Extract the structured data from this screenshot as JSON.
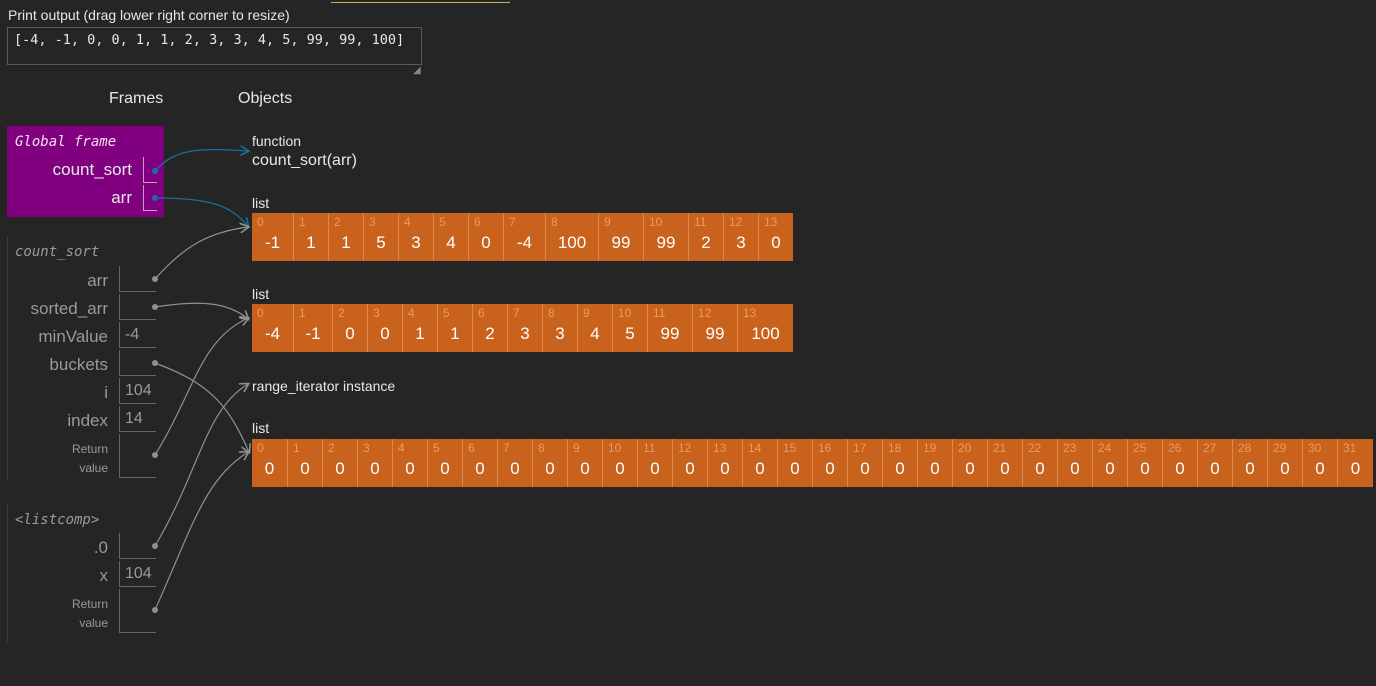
{
  "print_output": {
    "label": "Print output (drag lower right corner to resize)",
    "text": "[-4, -1, 0, 0, 1, 1, 2, 3, 3, 4, 5, 99, 99, 100]"
  },
  "headers": {
    "frames": "Frames",
    "objects": "Objects"
  },
  "global_frame": {
    "title": "Global frame",
    "vars": [
      {
        "name": "count_sort"
      },
      {
        "name": "arr"
      }
    ]
  },
  "count_sort_frame": {
    "title": "count_sort",
    "vars": [
      {
        "name": "arr",
        "value": ""
      },
      {
        "name": "sorted_arr",
        "value": ""
      },
      {
        "name": "minValue",
        "value": "-4"
      },
      {
        "name": "buckets",
        "value": ""
      },
      {
        "name": "i",
        "value": "104"
      },
      {
        "name": "index",
        "value": "14"
      }
    ],
    "return_label_1": "Return",
    "return_label_2": "value"
  },
  "listcomp_frame": {
    "title": "<listcomp>",
    "vars": [
      {
        "name": ".0",
        "value": ""
      },
      {
        "name": "x",
        "value": "104"
      }
    ],
    "return_label_1": "Return",
    "return_label_2": "value"
  },
  "objects": {
    "function": {
      "type_label": "function",
      "signature": "count_sort(arr)"
    },
    "list1": {
      "type_label": "list",
      "indices": [
        "0",
        "1",
        "2",
        "3",
        "4",
        "5",
        "6",
        "7",
        "8",
        "9",
        "10",
        "11",
        "12",
        "13"
      ],
      "values": [
        "-1",
        "1",
        "1",
        "5",
        "3",
        "4",
        "0",
        "-4",
        "100",
        "99",
        "99",
        "2",
        "3",
        "0"
      ]
    },
    "list2": {
      "type_label": "list",
      "indices": [
        "0",
        "1",
        "2",
        "3",
        "4",
        "5",
        "6",
        "7",
        "8",
        "9",
        "10",
        "11",
        "12",
        "13"
      ],
      "values": [
        "-4",
        "-1",
        "0",
        "0",
        "1",
        "1",
        "2",
        "3",
        "3",
        "4",
        "5",
        "99",
        "99",
        "100"
      ]
    },
    "range_iterator": {
      "type_label": "range_iterator instance"
    },
    "list3": {
      "type_label": "list",
      "indices": [
        "0",
        "1",
        "2",
        "3",
        "4",
        "5",
        "6",
        "7",
        "8",
        "9",
        "10",
        "11",
        "12",
        "13",
        "14",
        "15",
        "16",
        "17",
        "18",
        "19",
        "20",
        "21",
        "22",
        "23",
        "24",
        "25",
        "26",
        "27",
        "28",
        "29",
        "30",
        "31"
      ],
      "values": [
        "0",
        "0",
        "0",
        "0",
        "0",
        "0",
        "0",
        "0",
        "0",
        "0",
        "0",
        "0",
        "0",
        "0",
        "0",
        "0",
        "0",
        "0",
        "0",
        "0",
        "0",
        "0",
        "0",
        "0",
        "0",
        "0",
        "0",
        "0",
        "0",
        "0",
        "0",
        "0"
      ]
    }
  },
  "colors": {
    "background": "#252526",
    "global_frame": "#800080",
    "list_cell": "#c8621c",
    "active_arrow": "#1a6f9e",
    "inactive_arrow": "#909090"
  }
}
